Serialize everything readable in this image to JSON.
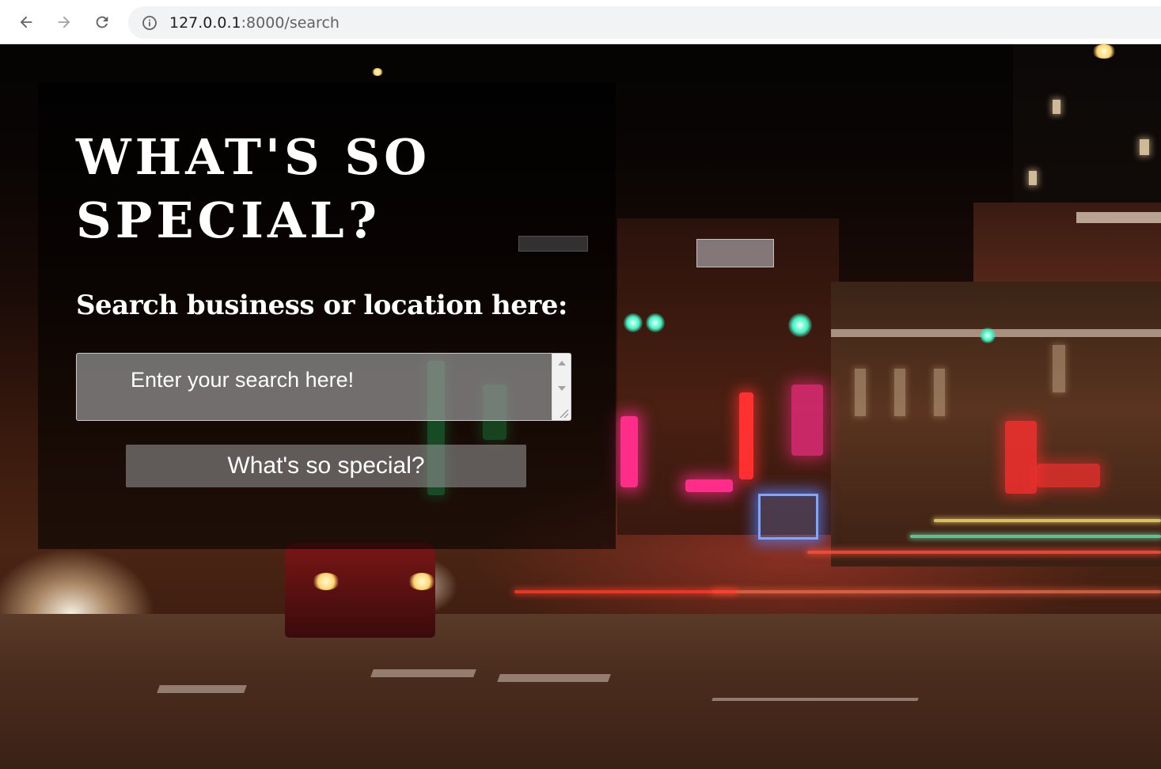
{
  "browser": {
    "url_host": "127.0.0.1",
    "url_path": ":8000/search",
    "icons": {
      "back": "arrow-left-icon",
      "forward": "arrow-right-icon",
      "reload": "reload-icon",
      "info": "info-icon"
    }
  },
  "hero": {
    "title": "What's so special?",
    "search_label": "Search business or location here:",
    "search_placeholder": "Enter your search here!",
    "submit_label": "What's so special?"
  },
  "colors": {
    "panel_overlay": "rgba(0,0,0,0.58)",
    "text": "#ffffff",
    "input_bg": "#969696",
    "button_bg": "#8c8c8c"
  }
}
